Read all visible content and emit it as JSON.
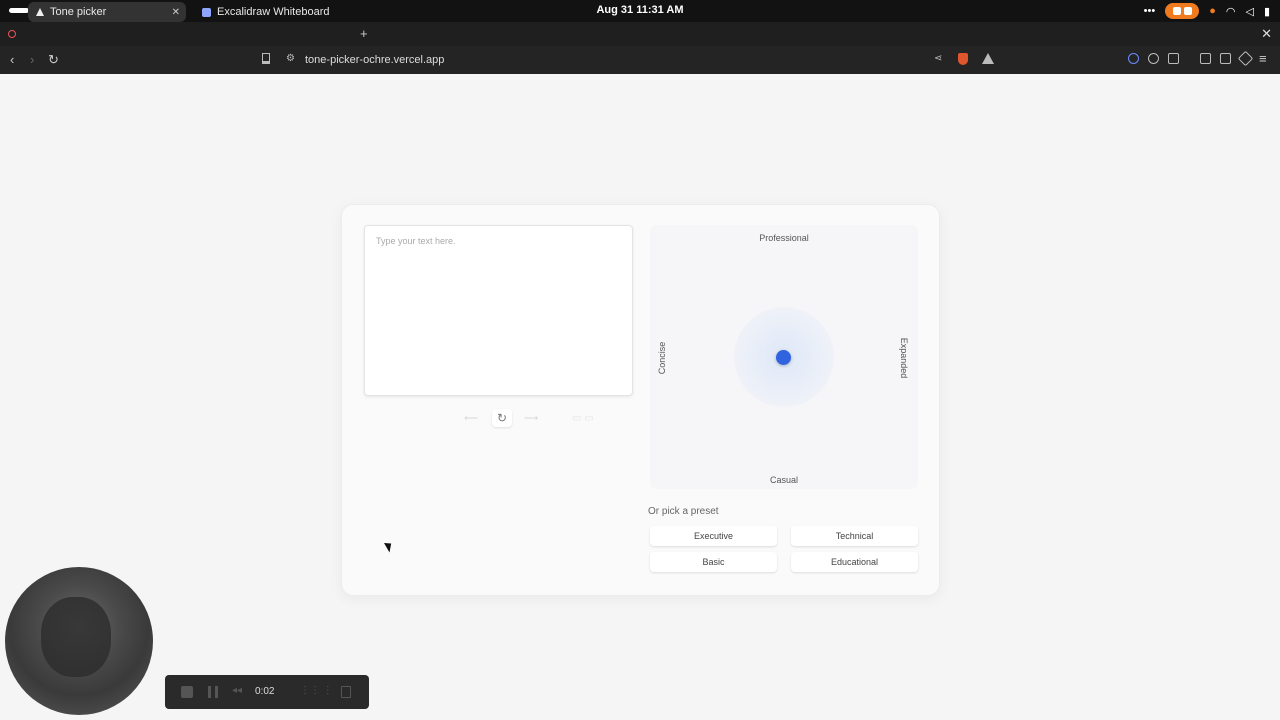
{
  "os_bar": {
    "clock": "Aug 31  11:31 AM"
  },
  "browser": {
    "tabs": [
      {
        "label": "Tone picker"
      },
      {
        "label": "Excalidraw Whiteboard"
      }
    ],
    "url": "tone-picker-ochre.vercel.app"
  },
  "app": {
    "text_placeholder": "Type your text here.",
    "axes": {
      "top": "Professional",
      "bottom": "Casual",
      "left": "Concise",
      "right": "Expanded"
    },
    "preset_title": "Or pick a preset",
    "presets": [
      "Executive",
      "Technical",
      "Basic",
      "Educational"
    ]
  },
  "recorder": {
    "timer": "0:02"
  },
  "colors": {
    "handle": "#2f63e0",
    "record_pill": "#f07b1f"
  }
}
